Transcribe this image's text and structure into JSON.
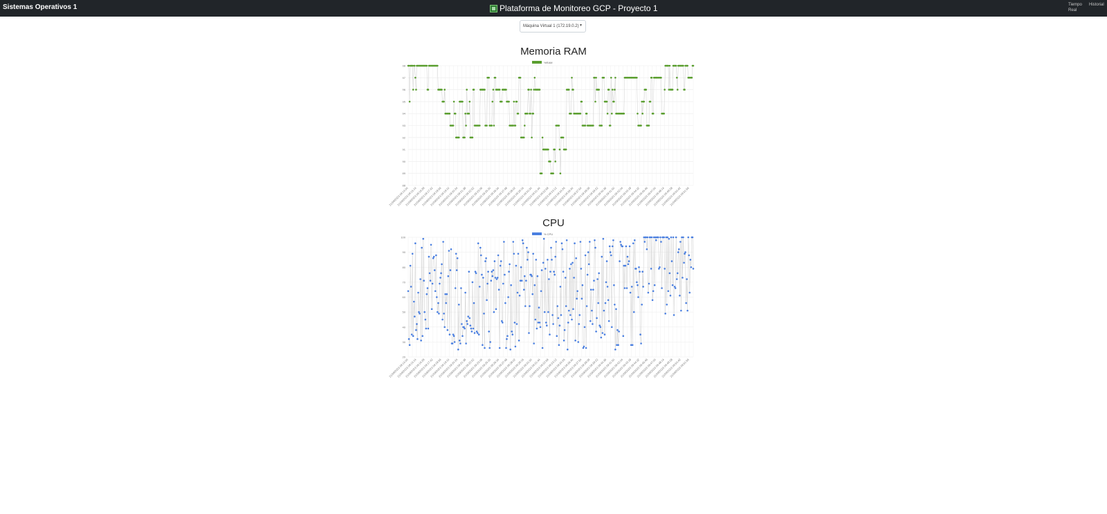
{
  "navbar": {
    "brand": "Sistemas Operativos 1",
    "title": "Plataforma de Monitoreo GCP - Proyecto 1",
    "logo_icon": "monitor-logo-icon",
    "links": [
      "Tiempo Real",
      "Historial"
    ]
  },
  "vm_select": {
    "selected": "Máquina Virtual 1 (172.19.0.2)"
  },
  "colors": {
    "navbar_bg": "#212529",
    "ram_series": "#5a9e2f",
    "cpu_series": "#4a7fe0",
    "connector_line": "#c8c8c8"
  },
  "chart_data": [
    {
      "type": "line",
      "title": "Memoria RAM",
      "series": [
        {
          "name": "%RAM",
          "color": "#5a9e2f"
        }
      ],
      "ylim": [
        88,
        98
      ],
      "yticks": [
        88,
        89,
        90,
        91,
        92,
        93,
        94,
        95,
        96,
        97,
        98
      ],
      "x_label_format": "21/09/2023 09:MM:SS",
      "x_tick_count": 70,
      "points": 400,
      "values_description_seed": 7,
      "grid": true,
      "legend": "top"
    },
    {
      "type": "line",
      "title": "CPU",
      "series": [
        {
          "name": "% CPU",
          "color": "#4a7fe0"
        }
      ],
      "ylim": [
        20,
        100
      ],
      "yticks": [
        20,
        30,
        40,
        50,
        60,
        70,
        80,
        90,
        100
      ],
      "x_label_format": "21/09/2023 09:MM:SS",
      "x_tick_count": 70,
      "points": 400,
      "grid": true,
      "legend": "top"
    }
  ]
}
